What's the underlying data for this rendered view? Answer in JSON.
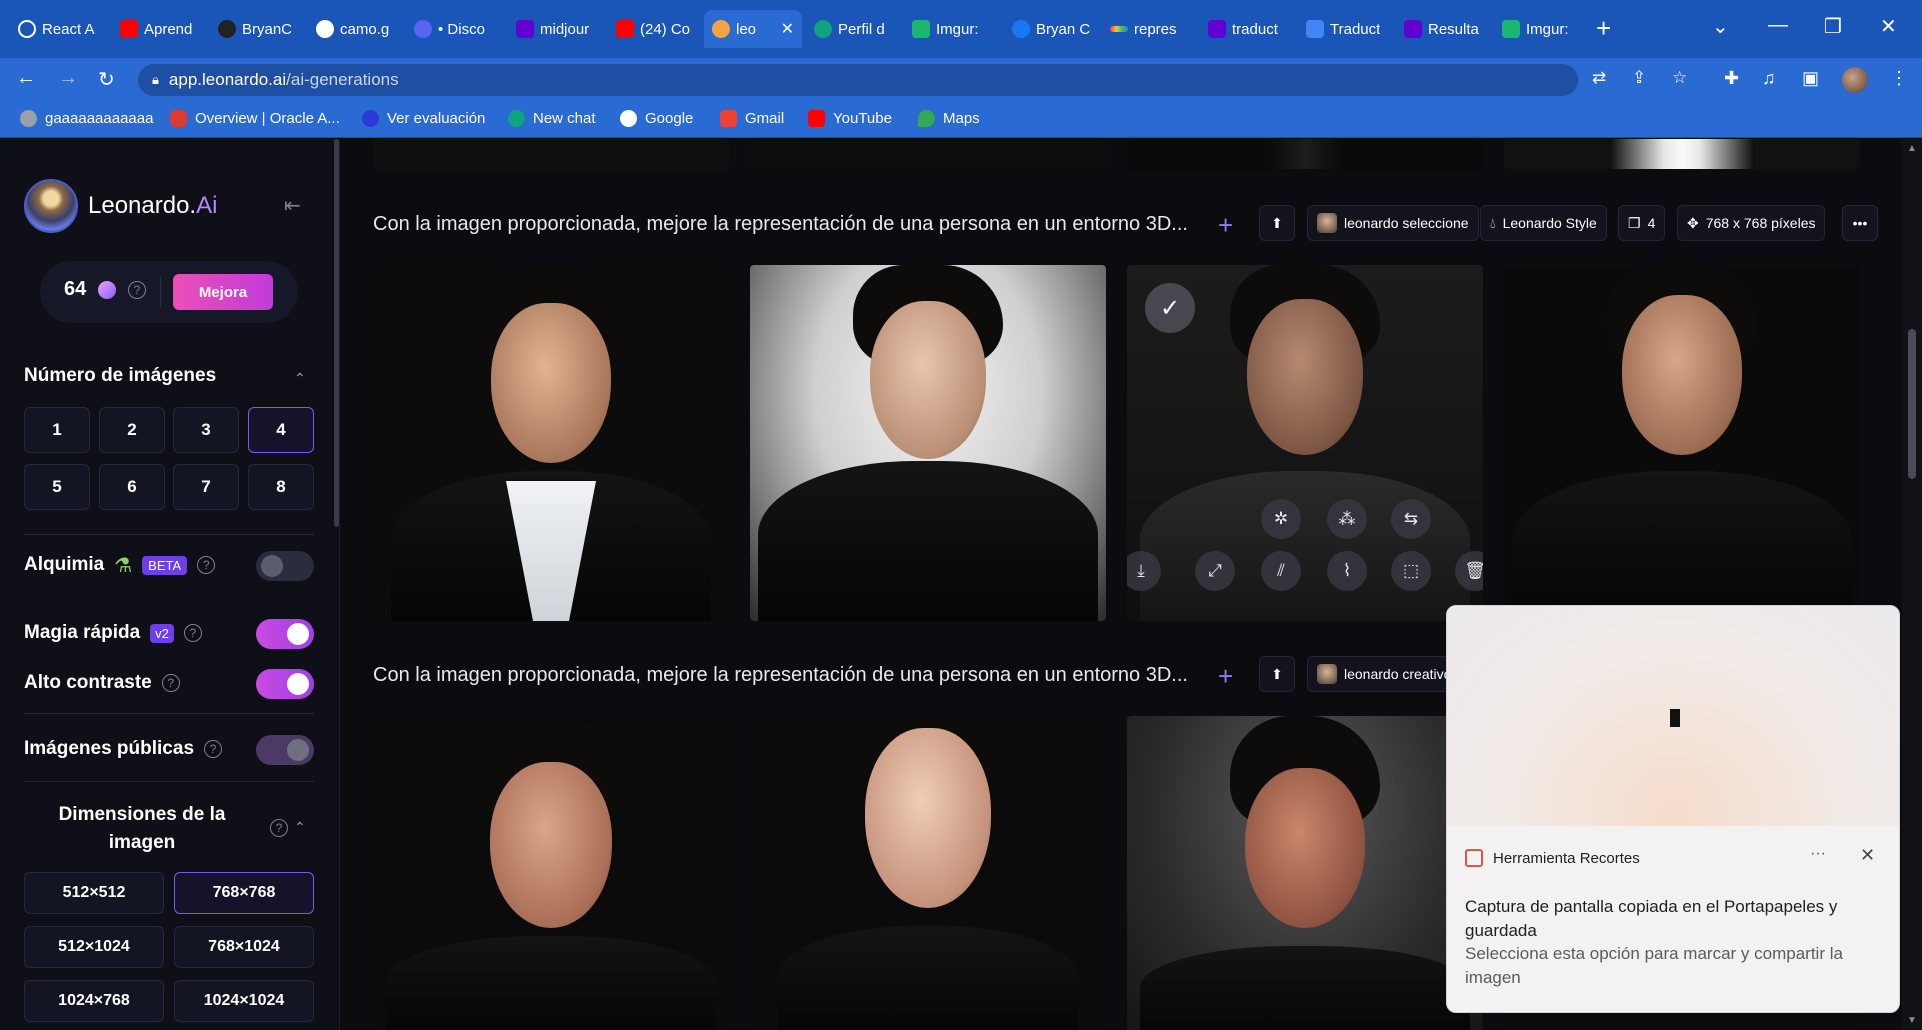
{
  "browser": {
    "tabs": [
      {
        "label": "React A",
        "color": "#61dafb"
      },
      {
        "label": "Aprend",
        "color": "#ff0000"
      },
      {
        "label": "BryanC",
        "color": "#222222"
      },
      {
        "label": "camo.g",
        "color": "#ffffff"
      },
      {
        "label": "• Disco",
        "color": "#5865f2"
      },
      {
        "label": "midjour",
        "color": "#6001d2"
      },
      {
        "label": "(24) Co",
        "color": "#ff0000"
      },
      {
        "label": "leo",
        "color": "#f4a340"
      },
      {
        "label": "Perfil d",
        "color": "#10a37f"
      },
      {
        "label": "Imgur:",
        "color": "#1bb76e"
      },
      {
        "label": "Bryan C",
        "color": "#1877f2"
      },
      {
        "label": "repres",
        "color": "#d94a8c"
      },
      {
        "label": "traduct",
        "color": "#6001d2"
      },
      {
        "label": "Traduct",
        "color": "#4285f4"
      },
      {
        "label": "Resulta",
        "color": "#6001d2"
      },
      {
        "label": "Imgur:",
        "color": "#1bb76e"
      }
    ],
    "url_host": "app.leonardo.ai",
    "url_path": "/ai-generations",
    "bookmarks": [
      {
        "label": "gaaaaaaaaaaaa",
        "color": "#9aa0a6"
      },
      {
        "label": "Overview | Oracle A...",
        "color": "#e03a2f"
      },
      {
        "label": "Ver evaluación",
        "color": "#2a3ad6"
      },
      {
        "label": "New chat",
        "color": "#10a37f"
      },
      {
        "label": "Google",
        "color": "#ffffff"
      },
      {
        "label": "Gmail",
        "color": "#ea4335"
      },
      {
        "label": "YouTube",
        "color": "#ff0000"
      },
      {
        "label": "Maps",
        "color": "#34a853"
      }
    ]
  },
  "sidebar": {
    "brand": "Leonardo.",
    "brand_ai": "Ai",
    "credits": "64",
    "upgrade_label": "Mejora",
    "num_images_title": "Número de imágenes",
    "num_images": [
      "1",
      "2",
      "3",
      "4",
      "5",
      "6",
      "7",
      "8"
    ],
    "num_images_selected": "4",
    "alchemy_label": "Alquimia",
    "alchemy_badge": "BETA",
    "alchemy_on": false,
    "magic_label": "Magia rápida",
    "magic_badge": "v2",
    "magic_on": true,
    "contrast_label": "Alto contraste",
    "contrast_on": true,
    "public_label": "Imágenes públicas",
    "public_on": true,
    "dims_title": "Dimensiones de la imagen",
    "dims": [
      "512×512",
      "768×768",
      "512×1024",
      "768×1024",
      "1024×768",
      "1024×1024"
    ],
    "dims_selected": "768×768"
  },
  "generations": [
    {
      "prompt": "Con la imagen proporcionada, mejore la representación de una persona en un entorno 3D...",
      "model": "leonardo seleccione",
      "style": "Leonardo Style",
      "count": "4",
      "size": "768 x 768 píxeles"
    },
    {
      "prompt": "Con la imagen proporcionada, mejore la representación de una persona en un entorno 3D...",
      "model": "leonardo creativo"
    }
  ],
  "toast": {
    "app": "Herramienta Recortes",
    "title": "Captura de pantalla copiada en el Portapapeles y guardada",
    "subtitle": "Selecciona esta opción para marcar y compartir la imagen"
  },
  "colors": {
    "accent": "#8f7bff",
    "brand_ai": "#b286ff",
    "upgrade_gradient": "#ec4fb6",
    "browser_frame": "#1a56b8"
  }
}
